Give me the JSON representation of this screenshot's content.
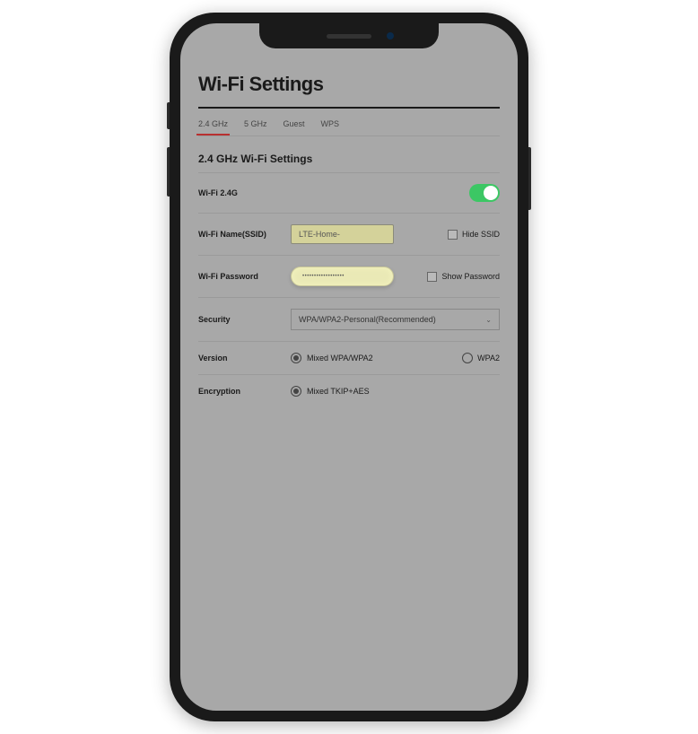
{
  "page": {
    "title": "Wi-Fi Settings"
  },
  "tabs": [
    {
      "label": "2.4 GHz",
      "active": true
    },
    {
      "label": "5 GHz",
      "active": false
    },
    {
      "label": "Guest",
      "active": false
    },
    {
      "label": "WPS",
      "active": false
    }
  ],
  "section": {
    "title": "2.4 GHz Wi-Fi Settings"
  },
  "wifi": {
    "enable_label": "Wi-Fi 2.4G",
    "enabled": true,
    "ssid_label": "Wi-Fi Name(SSID)",
    "ssid_value": "LTE-Home-",
    "hide_ssid_label": "Hide SSID",
    "hide_ssid_checked": false,
    "password_label": "Wi-Fi Password",
    "password_value": "••••••••••••••••••",
    "show_password_label": "Show Password",
    "show_password_checked": false
  },
  "security": {
    "label": "Security",
    "selected": "WPA/WPA2-Personal(Recommended)"
  },
  "version": {
    "label": "Version",
    "options": [
      {
        "label": "Mixed WPA/WPA2",
        "checked": true
      },
      {
        "label": "WPA2",
        "checked": false
      }
    ]
  },
  "encryption": {
    "label": "Encryption",
    "options": [
      {
        "label": "Mixed TKIP+AES",
        "checked": true
      }
    ]
  }
}
